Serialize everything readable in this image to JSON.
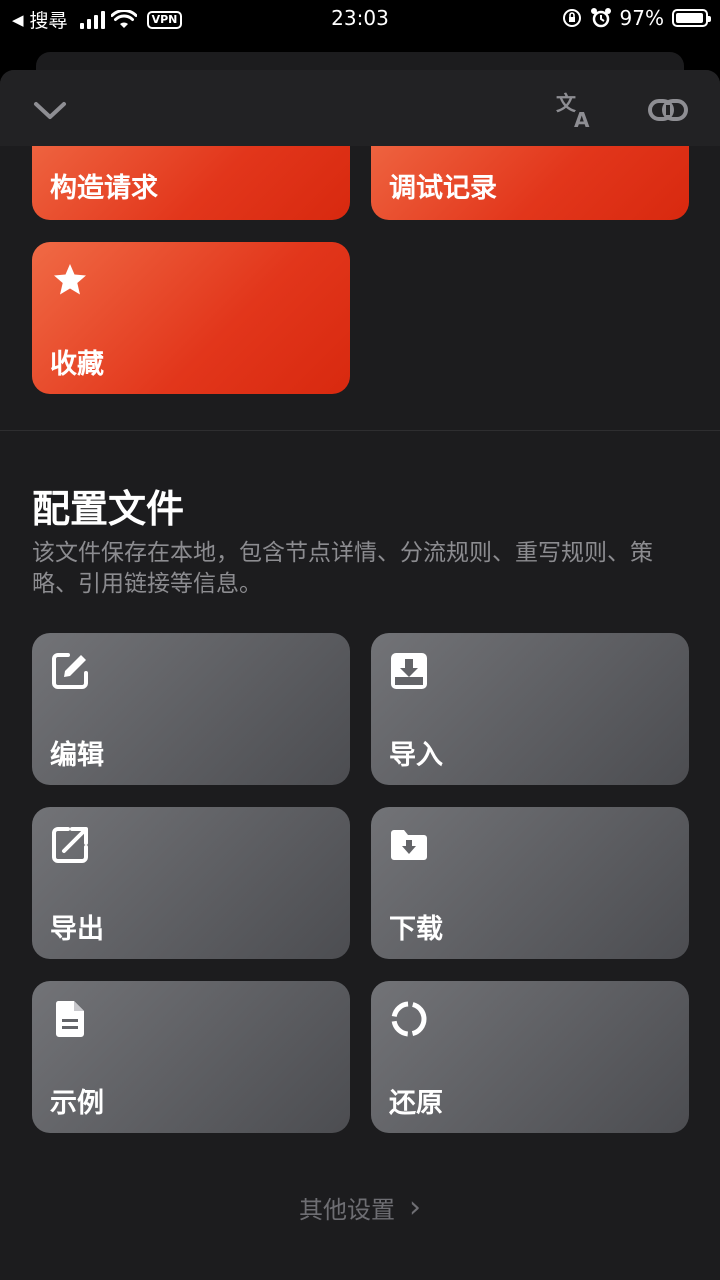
{
  "status_bar": {
    "back_arrow": "◀",
    "carrier_app": "搜尋",
    "vpn": "VPN",
    "time": "23:03",
    "battery_text": "97%",
    "battery_level": 0.97
  },
  "header": {
    "collapse_icon": "chevron-down-icon",
    "translate_icon": "translate-icon",
    "link_icon": "link-icon"
  },
  "top_cards": [
    {
      "label": "构造请求"
    },
    {
      "label": "调试记录"
    },
    {
      "label": "收藏",
      "icon": "star-icon"
    }
  ],
  "profile_section": {
    "title": "配置文件",
    "description": "该文件保存在本地，包含节点详情、分流规则、重写规则、策略、引用链接等信息。",
    "actions": [
      {
        "label": "编辑",
        "icon": "edit-icon"
      },
      {
        "label": "导入",
        "icon": "import-icon"
      },
      {
        "label": "导出",
        "icon": "export-icon"
      },
      {
        "label": "下载",
        "icon": "folder-download-icon"
      },
      {
        "label": "示例",
        "icon": "document-icon"
      },
      {
        "label": "还原",
        "icon": "restore-icon"
      }
    ]
  },
  "footer": {
    "more_settings": "其他设置",
    "chevron": "›"
  },
  "colors": {
    "accent_orange": "#e2361b",
    "card_gray": "#5d5e62",
    "sheet_bg": "#1c1c1e",
    "muted_text": "#8c8c90"
  }
}
